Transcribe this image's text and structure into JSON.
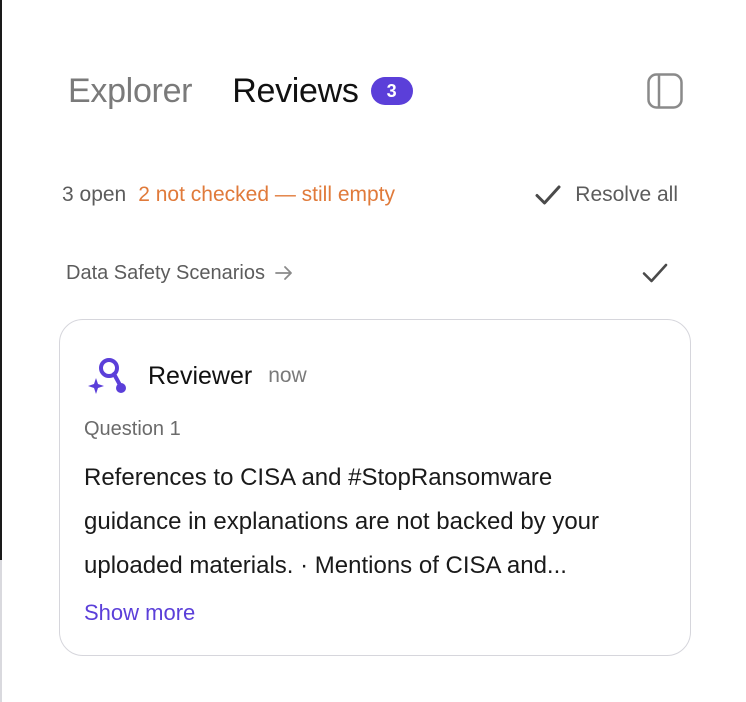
{
  "header": {
    "tabs": [
      {
        "label": "Explorer",
        "active": false
      },
      {
        "label": "Reviews",
        "active": true,
        "badge": "3"
      }
    ],
    "panel_toggle_icon": "sidebar-panel-icon"
  },
  "status": {
    "open_text": "3 open",
    "warning_text": "2 not checked — still empty",
    "resolve_all_label": "Resolve all",
    "resolve_icon": "check-icon"
  },
  "scenario": {
    "title": "Data Safety Scenarios",
    "arrow_icon": "arrow-right-icon",
    "check_icon": "check-icon"
  },
  "review_card": {
    "author": "Reviewer",
    "time": "now",
    "avatar_icon": "reviewer-sparkle-icon",
    "question_label": "Question 1",
    "body_lines": [
      "References to CISA and #StopRansomware",
      "guidance in explanations are not backed by your",
      "uploaded materials. · Mentions of CISA and..."
    ],
    "show_more_label": "Show more"
  },
  "colors": {
    "accent": "#5b3fd9",
    "warning": "#e07a3a",
    "muted_text": "#5c5c5c",
    "card_border": "#d6d6dc"
  }
}
